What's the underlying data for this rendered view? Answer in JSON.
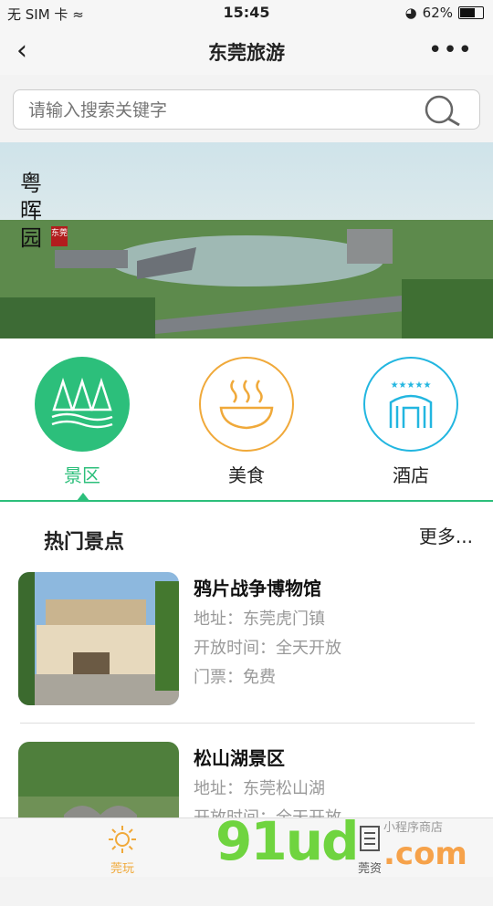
{
  "status_bar": {
    "carrier": "无 SIM 卡",
    "time": "15:45",
    "battery": "62%",
    "battery_level": 0.62
  },
  "nav": {
    "title": "东莞旅游"
  },
  "search": {
    "placeholder": "请输入搜索关键字"
  },
  "banner": {
    "calligraphy": "粤晖园",
    "stamp": "东莞"
  },
  "categories": [
    {
      "label": "景区",
      "color": "#2cbf7b",
      "icon": "trees-icon"
    },
    {
      "label": "美食",
      "color": "#f0a93a",
      "icon": "food-bowl-icon"
    },
    {
      "label": "酒店",
      "color": "#22b6e0",
      "icon": "hotel-icon"
    }
  ],
  "hot": {
    "title": "热门景点",
    "more": "更多...",
    "items": [
      {
        "name": "鸦片战争博物馆",
        "address": "地址：东莞虎门镇",
        "hours": "开放时间：全天开放",
        "ticket": "门票：免费"
      },
      {
        "name": "松山湖景区",
        "address": "地址：东莞松山湖",
        "hours": "开放时间：全天开放",
        "ticket": ""
      }
    ]
  },
  "tabbar": {
    "tab1": "莞玩",
    "tab2": "莞资"
  },
  "watermark": {
    "main": "91ud",
    "com": ".com",
    "shop": "小程序商店"
  }
}
